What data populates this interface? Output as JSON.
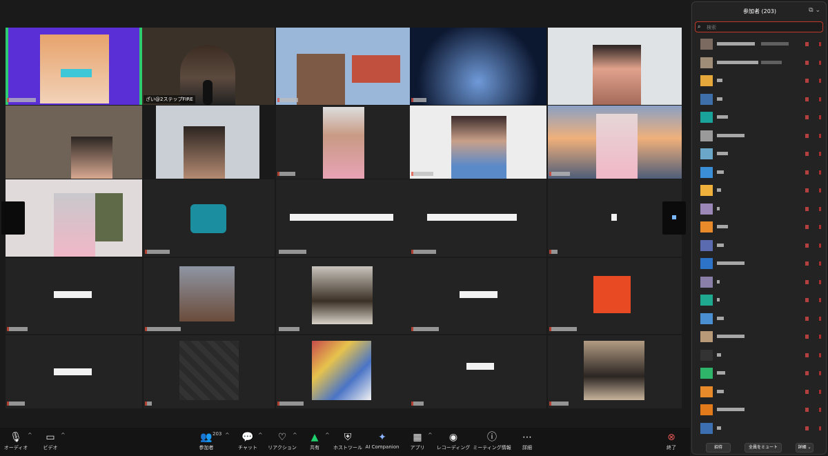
{
  "meeting": {
    "tiles": [
      {
        "name": ""
      },
      {
        "name": "ざい@2ステップFIRE"
      },
      {
        "name": ""
      },
      {
        "name": ""
      },
      {
        "name": ""
      }
    ]
  },
  "toolbar": {
    "audio": "オーディオ",
    "video": "ビデオ",
    "participants": "参加者",
    "participants_count": "203",
    "chat": "チャット",
    "reactions": "リアクション",
    "share": "共有",
    "host_tools": "ホストツール",
    "ai_companion": "AI Companion",
    "apps": "アプリ",
    "recording": "レコーディング",
    "meeting_info": "ミーティング情報",
    "more": "詳細",
    "end": "終了",
    "colors": {
      "share_accent": "#1fcf6b",
      "end_accent": "#e25555"
    }
  },
  "panel": {
    "title": "参加者 (203)",
    "search_placeholder": "検索",
    "footer": {
      "invite": "招待",
      "mute_all": "全員をミュート",
      "more": "詳細 ⌄"
    }
  }
}
